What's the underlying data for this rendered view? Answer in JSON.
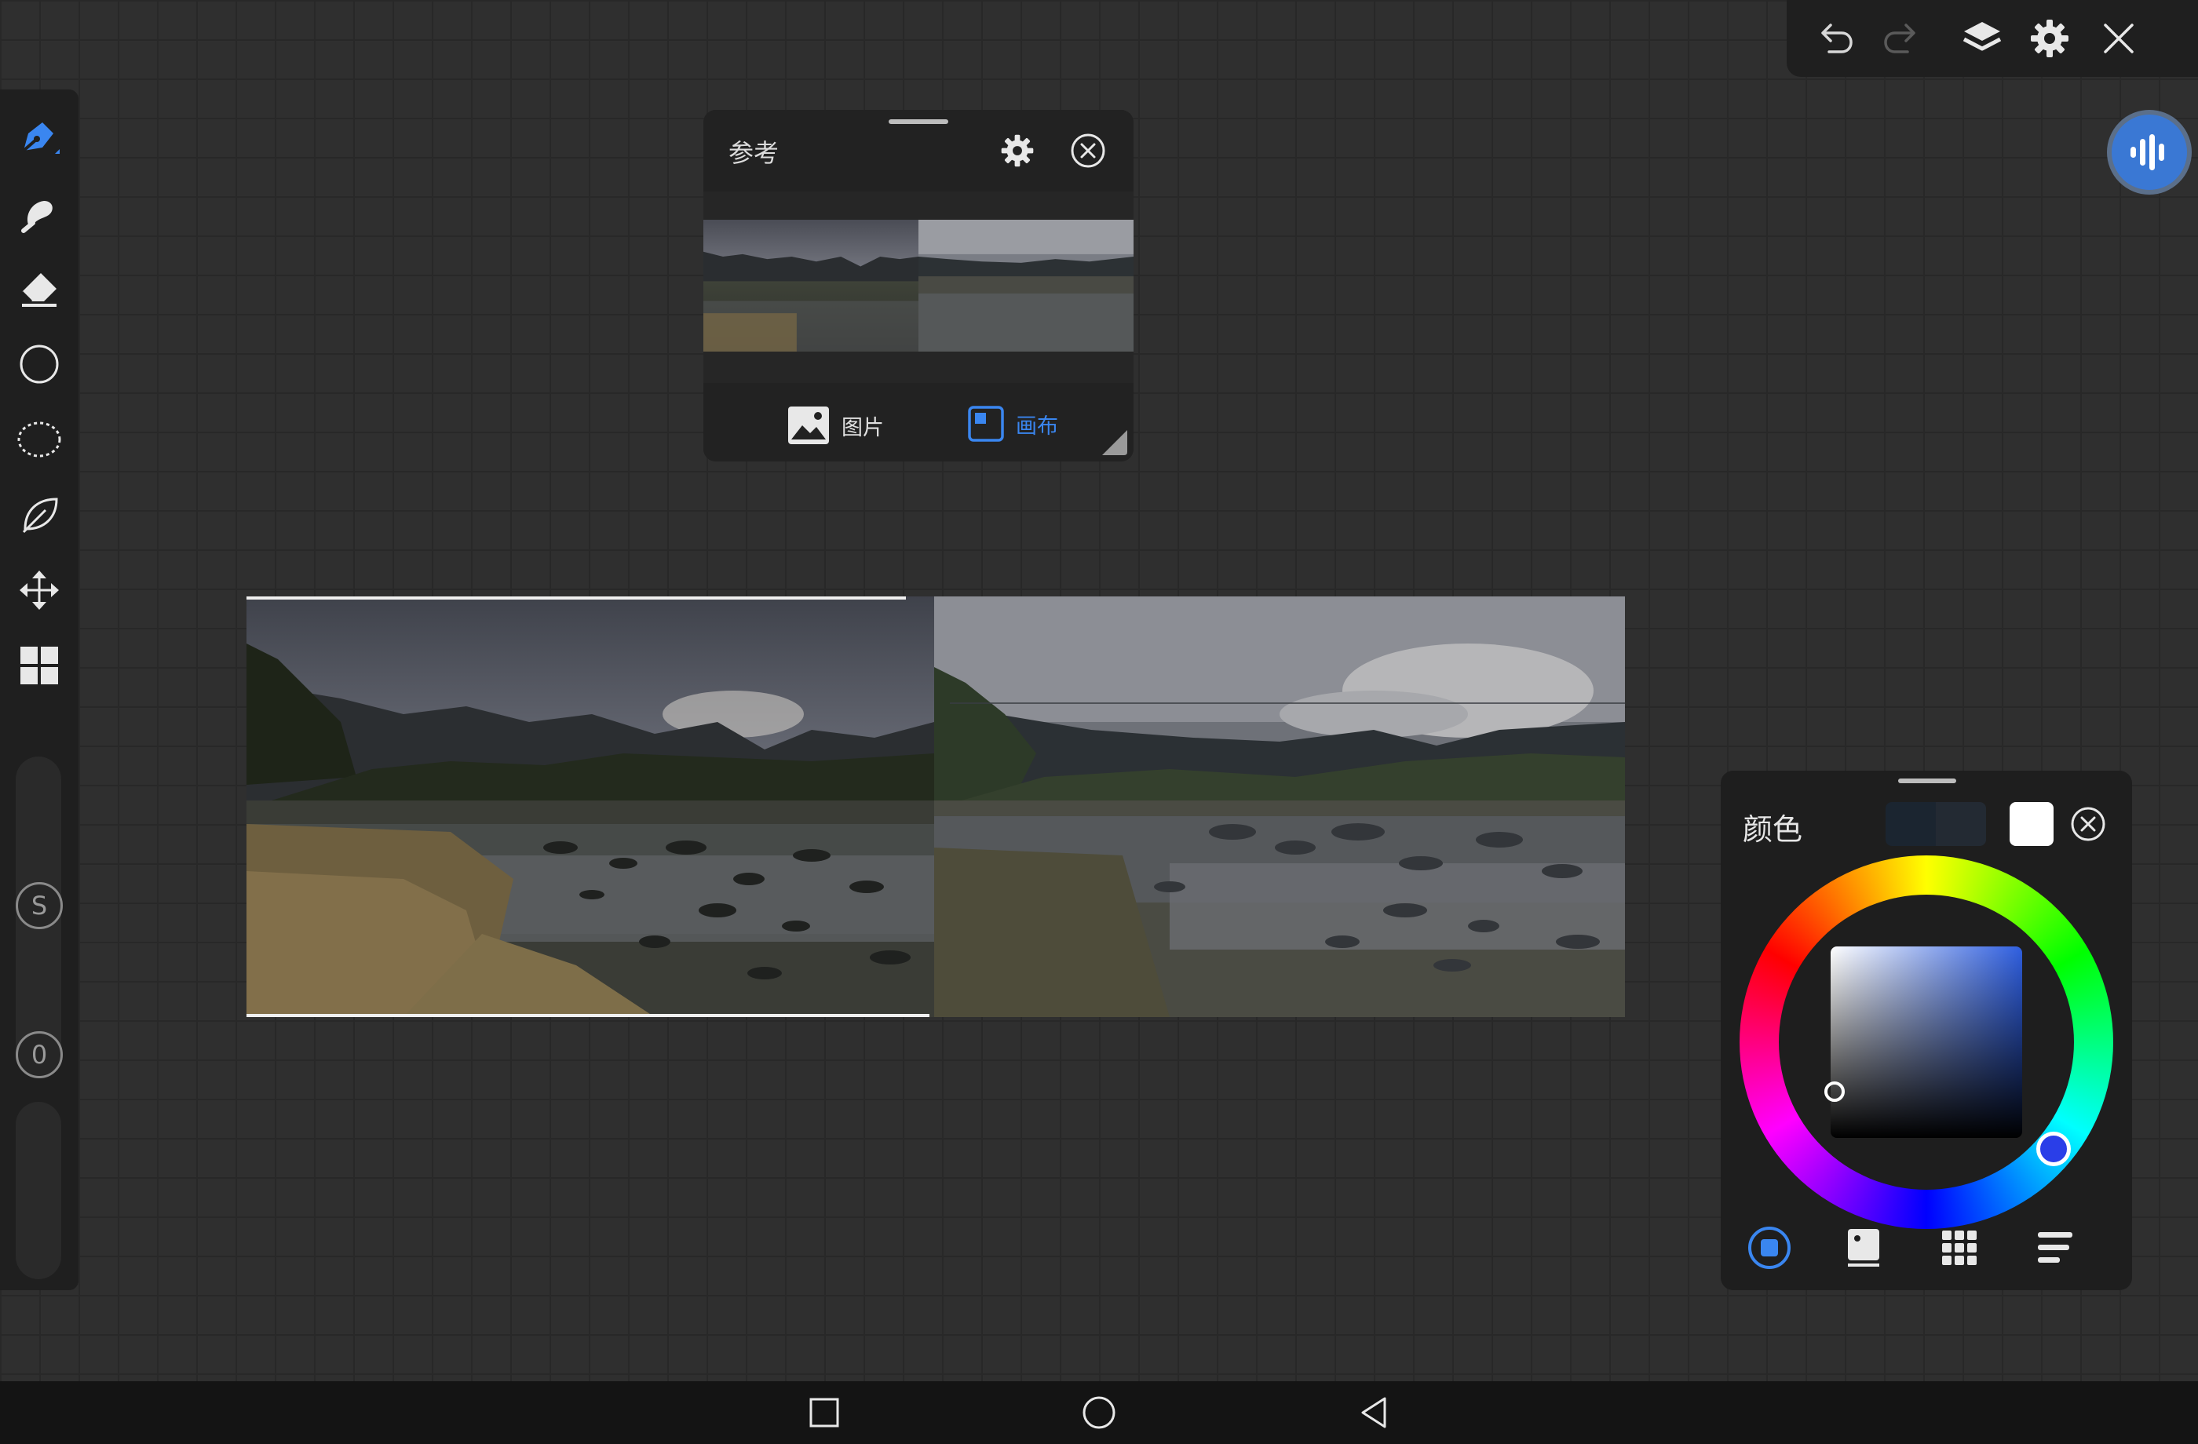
{
  "app": {
    "accent_color": "#3a78d4",
    "background_color": "#2f2f2f",
    "grid_color": "#282828"
  },
  "left_toolbar": {
    "tools": [
      {
        "name": "brush-icon",
        "active": true
      },
      {
        "name": "smudge-icon",
        "active": false
      },
      {
        "name": "eraser-icon",
        "active": false
      },
      {
        "name": "shape-icon",
        "active": false
      },
      {
        "name": "lasso-icon",
        "active": false
      },
      {
        "name": "fill-icon",
        "active": false
      },
      {
        "name": "transform-icon",
        "active": false
      },
      {
        "name": "layout-icon",
        "active": false
      }
    ],
    "size_slider_label": "S",
    "opacity_slider_label": "0"
  },
  "top_toolbar": {
    "buttons": [
      "undo-icon",
      "redo-icon",
      "layers-icon",
      "settings-icon",
      "close-icon"
    ]
  },
  "reference_panel": {
    "title": "参考",
    "tabs": [
      {
        "label": "图片",
        "icon": "image-icon",
        "active": false
      },
      {
        "label": "画布",
        "icon": "canvas-icon",
        "active": true
      }
    ]
  },
  "color_panel": {
    "title": "颜色",
    "current_color": "#ffffff",
    "previous_color": "#1d2632",
    "selected_hue_color": "#2f5fe0",
    "tabs": [
      {
        "icon": "color-wheel-tab-icon",
        "active": true
      },
      {
        "icon": "color-classic-tab-icon",
        "active": false
      },
      {
        "icon": "color-palette-tab-icon",
        "active": false
      },
      {
        "icon": "color-sliders-tab-icon",
        "active": false
      }
    ]
  },
  "nav_bar": {
    "buttons": [
      "recent-apps-icon",
      "home-icon",
      "back-icon"
    ]
  }
}
